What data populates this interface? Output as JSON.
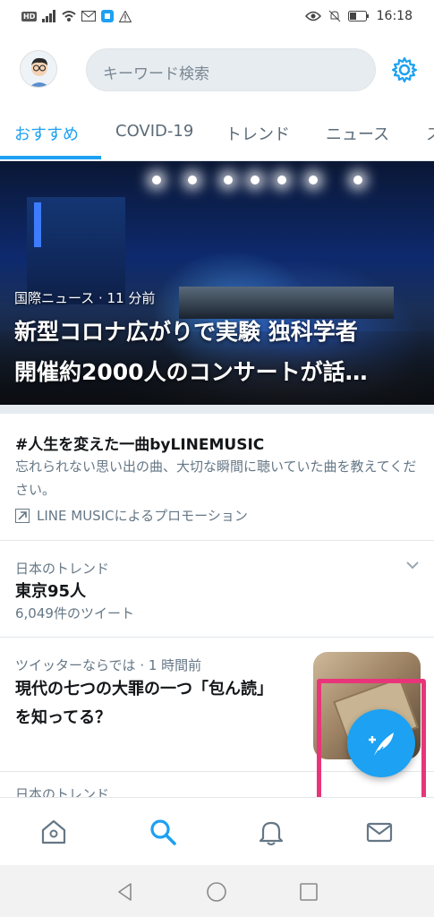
{
  "status_bar": {
    "hd_label": "HD",
    "time": "16:18"
  },
  "header": {
    "search_placeholder": "キーワード検索"
  },
  "tabs": [
    {
      "label": "おすすめ",
      "active": true
    },
    {
      "label": "COVID-19",
      "active": false
    },
    {
      "label": "トレンド",
      "active": false
    },
    {
      "label": "ニュース",
      "active": false
    },
    {
      "label": "ス",
      "active": false
    }
  ],
  "hero": {
    "meta": "国際ニュース · 11 分前",
    "title_line1": "新型コロナ広がりで実験 独科学者",
    "title_line2": "開催約2000人のコンサートが話…"
  },
  "promoted": {
    "title": "#人生を変えた一曲byLINEMUSIC",
    "description": "忘れられない思い出の曲、大切な瞬間に聴いていた曲を教えてください。",
    "by": "LINE MUSICによるプロモーション"
  },
  "trend": {
    "category": "日本のトレンド",
    "name": "東京95人",
    "count": "6,049件のツイート"
  },
  "news": {
    "meta": "ツイッターならでは · 1 時間前",
    "title": "現代の七つの大罪の一つ「包ん読」を知ってる？"
  },
  "next_trend_partial": "日本のトレンド",
  "colors": {
    "accent": "#1da1f2",
    "highlight": "#e8357a"
  },
  "icons": {
    "settings": "gear-icon",
    "home": "home-icon",
    "search": "search-icon",
    "notifications": "bell-icon",
    "messages": "mail-icon",
    "compose": "compose-icon",
    "promoted": "arrow-up-right-icon",
    "caret": "chevron-down-icon"
  }
}
